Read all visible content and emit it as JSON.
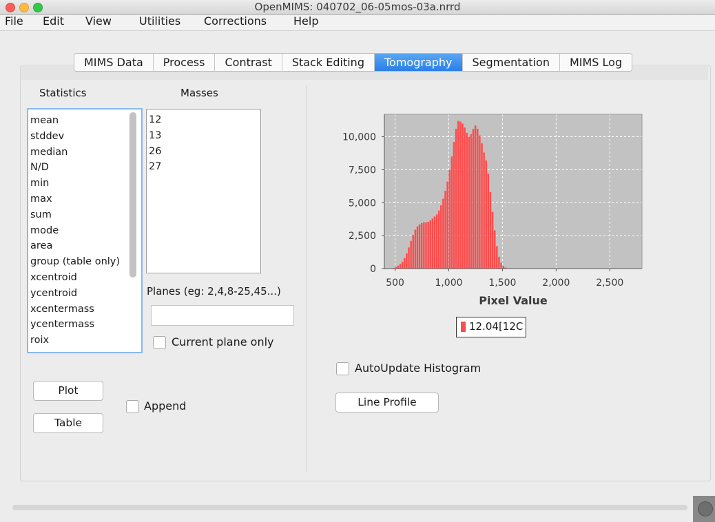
{
  "window": {
    "title": "OpenMIMS: 040702_06-05mos-03a.nrrd"
  },
  "menu": [
    "File",
    "Edit",
    "View",
    "Utilities",
    "Corrections",
    "Help"
  ],
  "tabs": [
    "MIMS Data",
    "Process",
    "Contrast",
    "Stack Editing",
    "Tomography",
    "Segmentation",
    "MIMS Log"
  ],
  "active_tab": "Tomography",
  "statistics": {
    "label": "Statistics",
    "items": [
      "mean",
      "stddev",
      "median",
      "N/D",
      "min",
      "max",
      "sum",
      "mode",
      "area",
      "group (table only)",
      "xcentroid",
      "ycentroid",
      "xcentermass",
      "ycentermass",
      "roix"
    ]
  },
  "masses": {
    "label": "Masses",
    "items": [
      "12",
      "13",
      "26",
      "27"
    ]
  },
  "planes": {
    "label": "Planes (eg: 2,4,8-25,45...)",
    "value": "",
    "current_plane_label": "Current plane only"
  },
  "buttons": {
    "plot": "Plot",
    "table": "Table",
    "append": "Append",
    "autoupdate": "AutoUpdate Histogram",
    "line_profile": "Line Profile"
  },
  "colors": {
    "bar": "#ff4c4c",
    "plot_bg": "#c2c2c2",
    "accent": "#2b7fe8"
  },
  "chart_data": {
    "type": "bar",
    "xlabel": "Pixel Value",
    "ylabel": "",
    "xlim": [
      400,
      2800
    ],
    "ylim": [
      0,
      11700
    ],
    "x_ticks": [
      500,
      1000,
      1500,
      2000,
      2500
    ],
    "x_tick_labels": [
      "500",
      "1,000",
      "1,500",
      "2,000",
      "2,500"
    ],
    "y_ticks": [
      0,
      2500,
      5000,
      7500,
      10000
    ],
    "y_tick_labels": [
      "0",
      "2,500",
      "5,000",
      "7,500",
      "10,000"
    ],
    "grid": true,
    "legend": "below",
    "series": [
      {
        "name": "12.04[12C",
        "color": "#ff4c4c",
        "bin_start": 480,
        "bin_width": 20,
        "values": [
          50,
          120,
          220,
          350,
          520,
          800,
          1150,
          1600,
          2100,
          2550,
          2950,
          3200,
          3350,
          3450,
          3500,
          3500,
          3550,
          3650,
          3800,
          3950,
          4100,
          4400,
          4800,
          5300,
          5900,
          6600,
          7500,
          8500,
          9600,
          10600,
          11200,
          11150,
          11000,
          10700,
          10300,
          10000,
          10200,
          10600,
          10850,
          10600,
          10100,
          9500,
          8800,
          8200,
          7200,
          5800,
          4300,
          2900,
          1700,
          900,
          450,
          200,
          80,
          30
        ]
      }
    ]
  }
}
